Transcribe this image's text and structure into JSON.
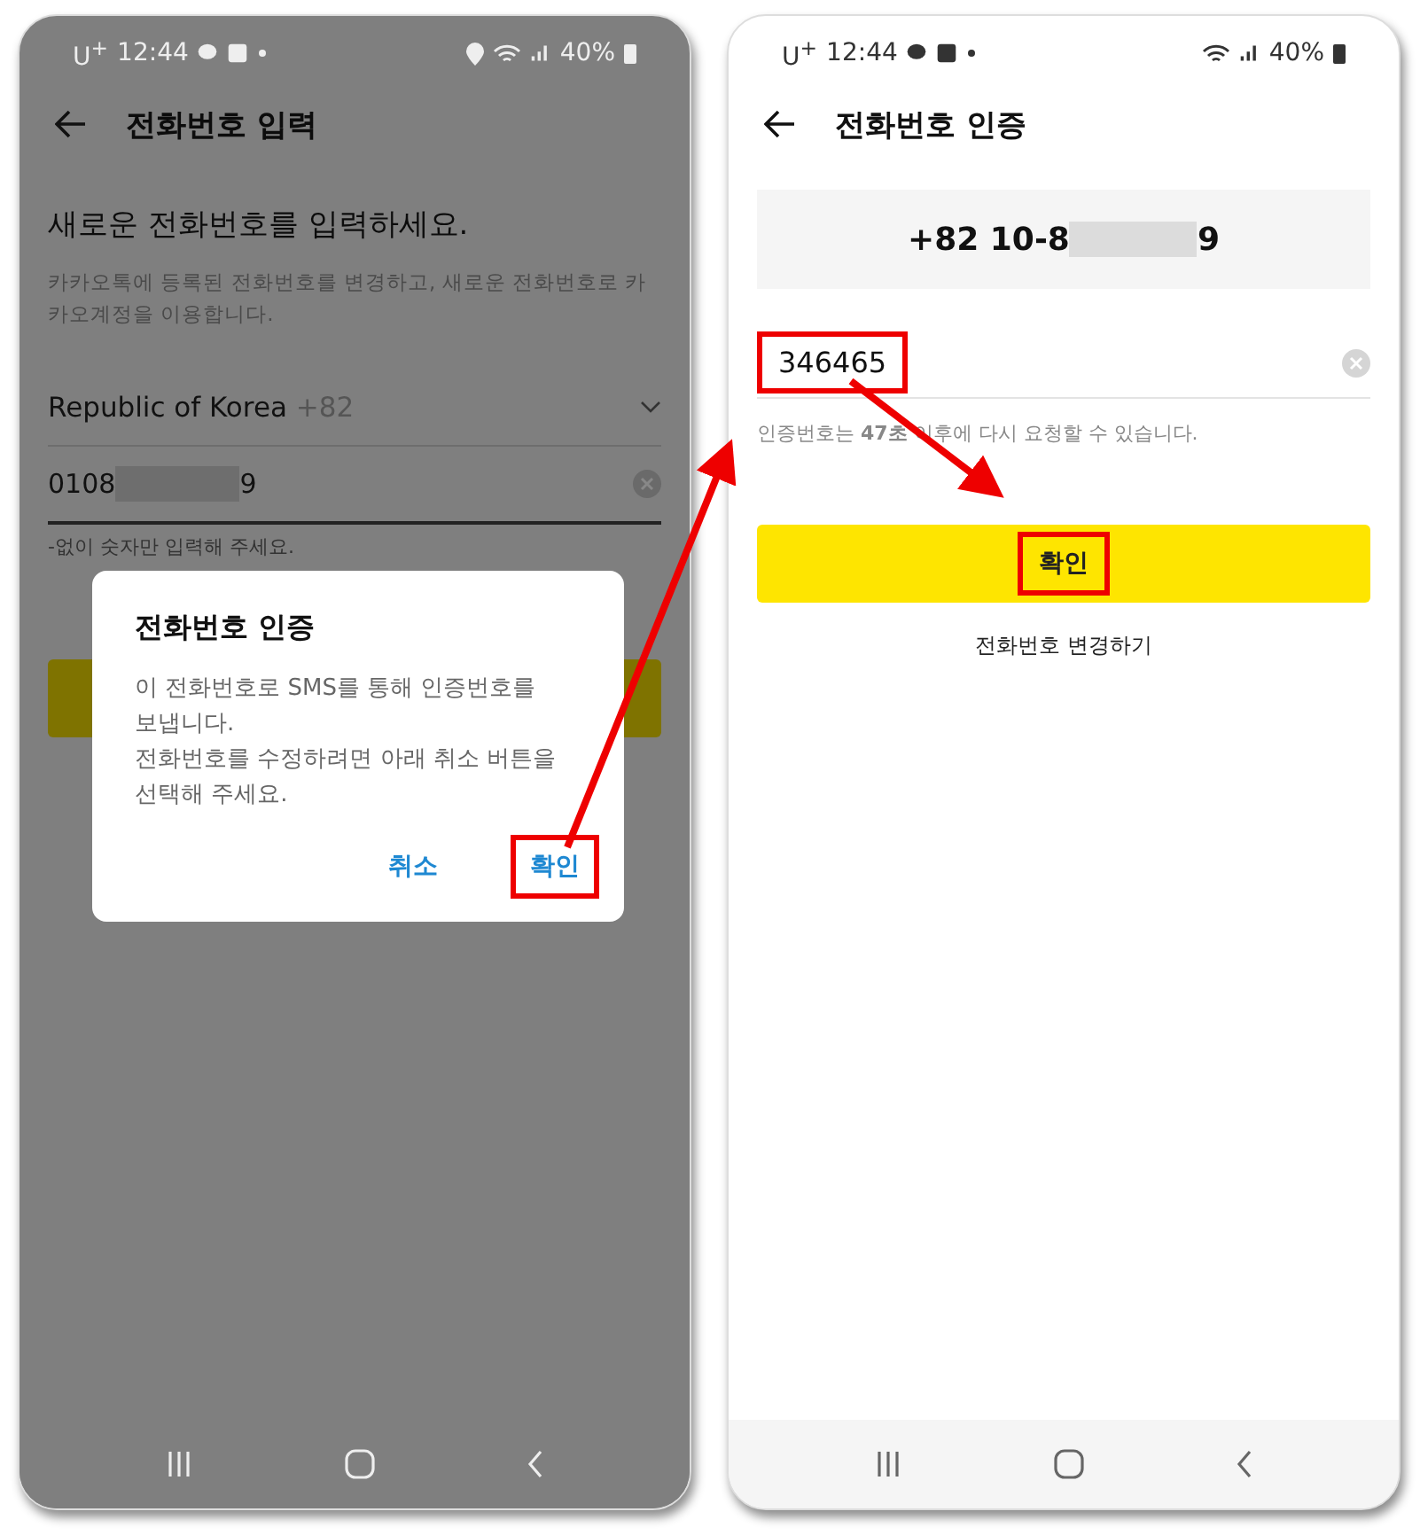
{
  "screens": [
    {
      "dimmed": true,
      "status_bar": {
        "carrier": "U$^{+}$",
        "time": "12:44",
        "battery": "40%",
        "location": true
      },
      "title": "전화번호 입력",
      "heading": "새로운 전화번호를 입력하세요.",
      "description": "카카오톡에 등록된 전화번호를 변경하고, 새로운 전화번호로 카카오계정을 이용합니다.",
      "country": {
        "name": "Republic of Korea",
        "code": "+82"
      },
      "phone_field": {
        "prefix": "0108",
        "suffix": "9"
      },
      "hint": "-없이 숫자만 입력해 주세요.",
      "dialog": {
        "title": "전화번호 인증",
        "message": "이 전화번호로 SMS를 통해 인증번호를\n보냅니다.\n전화번호를 수정하려면 아래 취소 버튼을\n선택해 주세요.",
        "buttons": [
          {
            "label": "취소",
            "annotated": false
          },
          {
            "label": "확인",
            "annotated": true
          }
        ]
      }
    },
    {
      "dimmed": false,
      "status_bar": {
        "carrier": "U$^{+}$",
        "time": "12:44",
        "battery": "40%",
        "location": false
      },
      "title": "전화번호 인증",
      "number_card": {
        "prefix": "+82 10-8",
        "suffix": "9"
      },
      "code_field": {
        "value": "346465",
        "annotated": true
      },
      "timer_hint": "인증번호는 **47초** 이후에 다시 요청할 수 있습니다.",
      "confirm_button": {
        "label": "확인",
        "annotated": true
      },
      "change_link": "전화번호 변경하기"
    }
  ]
}
